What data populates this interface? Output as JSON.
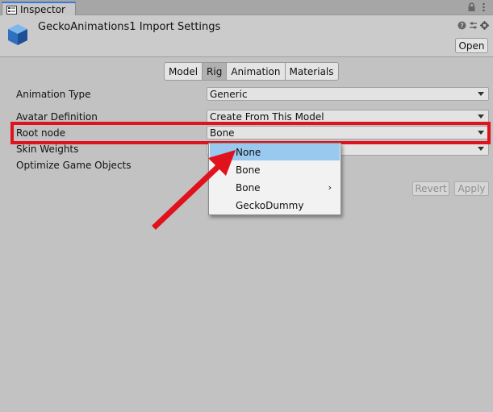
{
  "window": {
    "tab_title": "Inspector"
  },
  "header": {
    "title": "GeckoAnimations1 Import Settings",
    "open_label": "Open"
  },
  "tabs": [
    {
      "label": "Model",
      "active": false
    },
    {
      "label": "Rig",
      "active": true
    },
    {
      "label": "Animation",
      "active": false
    },
    {
      "label": "Materials",
      "active": false
    }
  ],
  "rows": [
    {
      "label": "Animation Type",
      "value": "Generic"
    },
    {
      "label": "Avatar Definition",
      "value": "Create From This Model"
    },
    {
      "label": "Root node",
      "value": "Bone"
    },
    {
      "label": "Skin Weights",
      "value": ""
    },
    {
      "label": "Optimize Game Objects",
      "value": ""
    }
  ],
  "buttons": {
    "revert": "Revert",
    "apply": "Apply"
  },
  "root_node_menu": [
    {
      "label": "None",
      "selected": true,
      "submenu": false
    },
    {
      "label": "Bone",
      "selected": false,
      "submenu": false
    },
    {
      "label": "Bone",
      "selected": false,
      "submenu": true
    },
    {
      "label": "GeckoDummy",
      "selected": false,
      "submenu": false
    }
  ],
  "submenu_glyph": "›",
  "colors": {
    "highlight": "#e0121b",
    "selection": "#99c9ef",
    "tab_accent": "#3a79d9"
  }
}
